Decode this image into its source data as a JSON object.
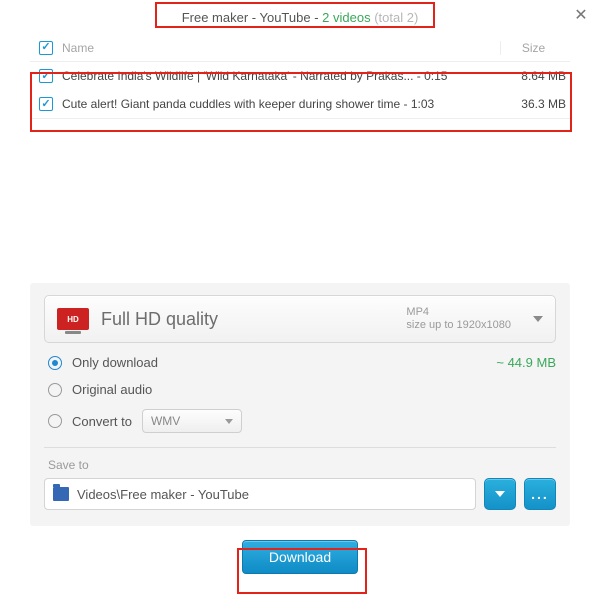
{
  "title": {
    "app": "Free maker - YouTube",
    "sep": " - ",
    "count": "2 videos",
    "total": "(total 2)"
  },
  "columns": {
    "name": "Name",
    "size": "Size"
  },
  "checkmark": "✓",
  "rows": [
    {
      "checked": true,
      "name": "Celebrate India's Wildlife | 'Wild Karnataka' - Narrated by Prakas... - 0:15",
      "size": "8.64 MB"
    },
    {
      "checked": true,
      "name": "Cute alert! Giant panda cuddles with keeper during shower time - 1:03",
      "size": "36.3 MB"
    }
  ],
  "quality": {
    "badge": "HD",
    "label": "Full HD quality",
    "format": "MP4",
    "meta": "size up to 1920x1080"
  },
  "radios": {
    "only_download": "Only download",
    "original_audio": "Original audio",
    "convert_to": "Convert to",
    "convert_value": "WMV",
    "estimate": "~ 44.9 MB"
  },
  "save": {
    "label": "Save to",
    "path": "Videos\\Free maker - YouTube",
    "browse": "..."
  },
  "download": "Download",
  "close_glyph": "✕"
}
